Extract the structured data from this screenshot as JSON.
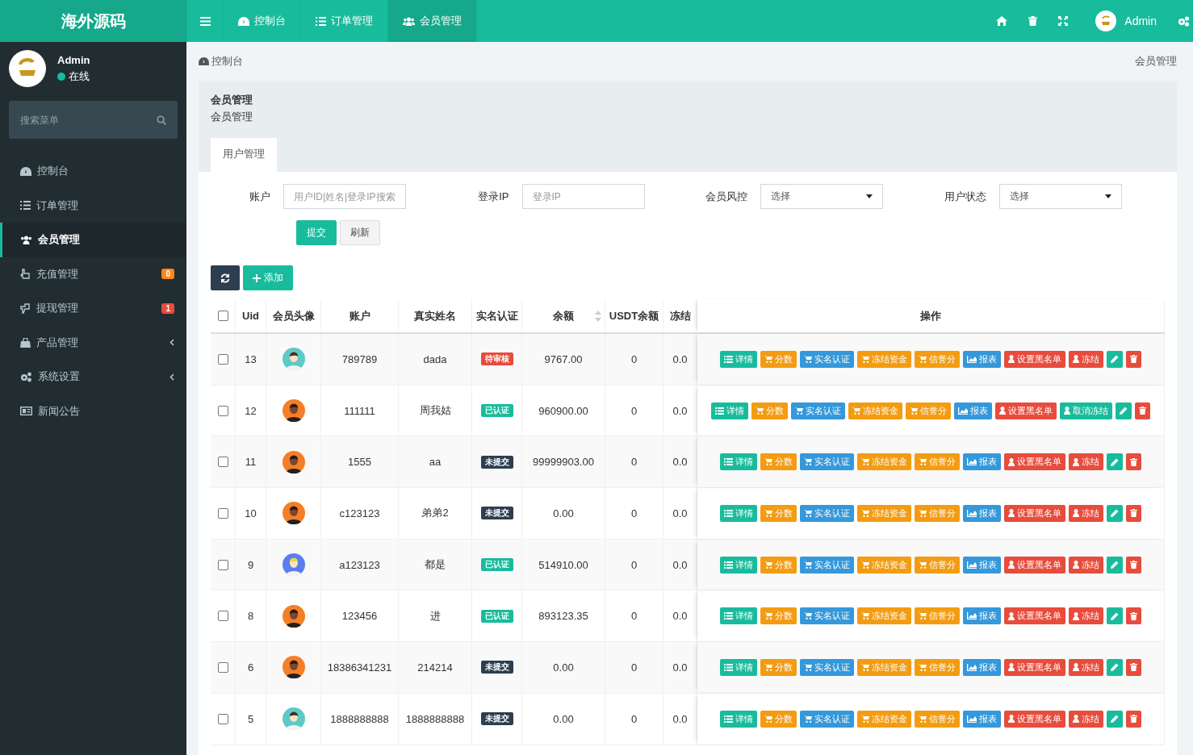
{
  "brand": "海外源码",
  "topnav": [
    {
      "label": "控制台",
      "kind": "dashboard",
      "selected": false
    },
    {
      "label": "订单管理",
      "kind": "list",
      "selected": false
    },
    {
      "label": "会员管理",
      "kind": "users",
      "selected": true
    }
  ],
  "top_user": "Admin",
  "sidebar": {
    "user": "Admin",
    "status": "在线",
    "search_placeholder": "搜索菜单",
    "items": [
      {
        "label": "控制台",
        "kind": "dashboard",
        "selected": false
      },
      {
        "label": "订单管理",
        "kind": "list",
        "selected": false
      },
      {
        "label": "会员管理",
        "kind": "users",
        "selected": true
      },
      {
        "label": "充值管理",
        "kind": "hand-up",
        "selected": false,
        "badge": {
          "text": "0",
          "color": "#ff851b"
        }
      },
      {
        "label": "提现管理",
        "kind": "hand-down",
        "selected": false,
        "badge": {
          "text": "1",
          "color": "#e74c3c"
        }
      },
      {
        "label": "产品管理",
        "kind": "bag",
        "selected": false,
        "expanded": false
      },
      {
        "label": "系统设置",
        "kind": "gears",
        "selected": false,
        "expanded": false
      },
      {
        "label": "新闻公告",
        "kind": "news",
        "selected": false
      }
    ]
  },
  "breadcrumb": {
    "left": "控制台",
    "right": "会员管理"
  },
  "panel": {
    "title": "会员管理",
    "subtitle": "会员管理",
    "tabs": [
      {
        "label": "用户管理",
        "selected": true
      }
    ]
  },
  "filters": [
    {
      "label": "账户",
      "kind": "input",
      "placeholder": "用户ID|姓名|登录IP搜索"
    },
    {
      "label": "登录IP",
      "kind": "input",
      "placeholder": "登录IP"
    },
    {
      "label": "会员风控",
      "kind": "select",
      "value": "选择"
    },
    {
      "label": "用户状态",
      "kind": "select",
      "value": "选择"
    }
  ],
  "filter_buttons": [
    {
      "label": "提交",
      "kind": "primary"
    },
    {
      "label": "刷新",
      "kind": "default"
    }
  ],
  "toolbar": {
    "add": "添加"
  },
  "table": {
    "select_all": {
      "checked": false
    },
    "columns": [
      {
        "label": "Uid"
      },
      {
        "label": "会员头像"
      },
      {
        "label": "账户"
      },
      {
        "label": "真实姓名"
      },
      {
        "label": "实名认证"
      },
      {
        "label": "余额",
        "sortable": true
      },
      {
        "label": "USDT余额"
      },
      {
        "label": "冻结"
      },
      {
        "label": "操作"
      }
    ],
    "rows": [
      {
        "uid": "13",
        "avatar": {
          "kind": "suit"
        },
        "account": "789789",
        "name": "dada",
        "cert": {
          "label": "待审核",
          "kind": "pending"
        },
        "balance": "9767.00",
        "usdt": "0",
        "frozen": "0.0",
        "checked": false,
        "actions": [
          {
            "kind": "detail",
            "label": "详情"
          },
          {
            "kind": "score",
            "label": "分数"
          },
          {
            "kind": "realname",
            "label": "实名认证"
          },
          {
            "kind": "freeze_funds",
            "label": "冻结资金"
          },
          {
            "kind": "credit",
            "label": "信誉分"
          },
          {
            "kind": "report",
            "label": "报表"
          },
          {
            "kind": "blacklist",
            "label": "设置黑名单"
          },
          {
            "kind": "freeze",
            "label": "冻结"
          },
          {
            "kind": "edit"
          },
          {
            "kind": "delete"
          }
        ]
      },
      {
        "uid": "12",
        "avatar": {
          "kind": "dark"
        },
        "account": "111111",
        "name": "周我姑",
        "cert": {
          "label": "已认证",
          "kind": "verified"
        },
        "balance": "960900.00",
        "usdt": "0",
        "frozen": "0.0",
        "checked": false,
        "actions": [
          {
            "kind": "detail",
            "label": "详情"
          },
          {
            "kind": "score",
            "label": "分数"
          },
          {
            "kind": "realname",
            "label": "实名认证"
          },
          {
            "kind": "freeze_funds",
            "label": "冻结资金"
          },
          {
            "kind": "credit",
            "label": "信誉分"
          },
          {
            "kind": "report",
            "label": "报表"
          },
          {
            "kind": "blacklist",
            "label": "设置黑名单"
          },
          {
            "kind": "unfreeze",
            "label": "取消冻结"
          },
          {
            "kind": "edit"
          },
          {
            "kind": "delete"
          }
        ]
      },
      {
        "uid": "11",
        "avatar": {
          "kind": "dark"
        },
        "account": "1555",
        "name": "aa",
        "cert": {
          "label": "未提交",
          "kind": "unsubmitted"
        },
        "balance": "99999903.00",
        "usdt": "0",
        "frozen": "0.0",
        "checked": false,
        "actions": [
          {
            "kind": "detail",
            "label": "详情"
          },
          {
            "kind": "score",
            "label": "分数"
          },
          {
            "kind": "realname",
            "label": "实名认证"
          },
          {
            "kind": "freeze_funds",
            "label": "冻结资金"
          },
          {
            "kind": "credit",
            "label": "信誉分"
          },
          {
            "kind": "report",
            "label": "报表"
          },
          {
            "kind": "blacklist",
            "label": "设置黑名单"
          },
          {
            "kind": "freeze",
            "label": "冻结"
          },
          {
            "kind": "edit"
          },
          {
            "kind": "delete"
          }
        ]
      },
      {
        "uid": "10",
        "avatar": {
          "kind": "dark"
        },
        "account": "c123123",
        "name": "弟弟2",
        "cert": {
          "label": "未提交",
          "kind": "unsubmitted"
        },
        "balance": "0.00",
        "usdt": "0",
        "frozen": "0.0",
        "checked": false,
        "actions": [
          {
            "kind": "detail",
            "label": "详情"
          },
          {
            "kind": "score",
            "label": "分数"
          },
          {
            "kind": "realname",
            "label": "实名认证"
          },
          {
            "kind": "freeze_funds",
            "label": "冻结资金"
          },
          {
            "kind": "credit",
            "label": "信誉分"
          },
          {
            "kind": "report",
            "label": "报表"
          },
          {
            "kind": "blacklist",
            "label": "设置黑名单"
          },
          {
            "kind": "freeze",
            "label": "冻结"
          },
          {
            "kind": "edit"
          },
          {
            "kind": "delete"
          }
        ]
      },
      {
        "uid": "9",
        "avatar": {
          "kind": "blond"
        },
        "account": "a123123",
        "name": "都是",
        "cert": {
          "label": "已认证",
          "kind": "verified"
        },
        "balance": "514910.00",
        "usdt": "0",
        "frozen": "0.0",
        "checked": false,
        "actions": [
          {
            "kind": "detail",
            "label": "详情"
          },
          {
            "kind": "score",
            "label": "分数"
          },
          {
            "kind": "realname",
            "label": "实名认证"
          },
          {
            "kind": "freeze_funds",
            "label": "冻结资金"
          },
          {
            "kind": "credit",
            "label": "信誉分"
          },
          {
            "kind": "report",
            "label": "报表"
          },
          {
            "kind": "blacklist",
            "label": "设置黑名单"
          },
          {
            "kind": "freeze",
            "label": "冻结"
          },
          {
            "kind": "edit"
          },
          {
            "kind": "delete"
          }
        ]
      },
      {
        "uid": "8",
        "avatar": {
          "kind": "dark"
        },
        "account": "123456",
        "name": "进",
        "cert": {
          "label": "已认证",
          "kind": "verified"
        },
        "balance": "893123.35",
        "usdt": "0",
        "frozen": "0.0",
        "checked": false,
        "actions": [
          {
            "kind": "detail",
            "label": "详情"
          },
          {
            "kind": "score",
            "label": "分数"
          },
          {
            "kind": "realname",
            "label": "实名认证"
          },
          {
            "kind": "freeze_funds",
            "label": "冻结资金"
          },
          {
            "kind": "credit",
            "label": "信誉分"
          },
          {
            "kind": "report",
            "label": "报表"
          },
          {
            "kind": "blacklist",
            "label": "设置黑名单"
          },
          {
            "kind": "freeze",
            "label": "冻结"
          },
          {
            "kind": "edit"
          },
          {
            "kind": "delete"
          }
        ]
      },
      {
        "uid": "6",
        "avatar": {
          "kind": "dark"
        },
        "account": "18386341231",
        "name": "214214",
        "cert": {
          "label": "未提交",
          "kind": "unsubmitted"
        },
        "balance": "0.00",
        "usdt": "0",
        "frozen": "0.0",
        "checked": false,
        "actions": [
          {
            "kind": "detail",
            "label": "详情"
          },
          {
            "kind": "score",
            "label": "分数"
          },
          {
            "kind": "realname",
            "label": "实名认证"
          },
          {
            "kind": "freeze_funds",
            "label": "冻结资金"
          },
          {
            "kind": "credit",
            "label": "信誉分"
          },
          {
            "kind": "report",
            "label": "报表"
          },
          {
            "kind": "blacklist",
            "label": "设置黑名单"
          },
          {
            "kind": "freeze",
            "label": "冻结"
          },
          {
            "kind": "edit"
          },
          {
            "kind": "delete"
          }
        ]
      },
      {
        "uid": "5",
        "avatar": {
          "kind": "suit"
        },
        "account": "1888888888",
        "name": "1888888888",
        "cert": {
          "label": "未提交",
          "kind": "unsubmitted"
        },
        "balance": "0.00",
        "usdt": "0",
        "frozen": "0.0",
        "checked": false,
        "actions": [
          {
            "kind": "detail",
            "label": "详情"
          },
          {
            "kind": "score",
            "label": "分数"
          },
          {
            "kind": "realname",
            "label": "实名认证"
          },
          {
            "kind": "freeze_funds",
            "label": "冻结资金"
          },
          {
            "kind": "credit",
            "label": "信誉分"
          },
          {
            "kind": "report",
            "label": "报表"
          },
          {
            "kind": "blacklist",
            "label": "设置黑名单"
          },
          {
            "kind": "freeze",
            "label": "冻结"
          },
          {
            "kind": "edit"
          },
          {
            "kind": "delete"
          }
        ]
      }
    ]
  }
}
